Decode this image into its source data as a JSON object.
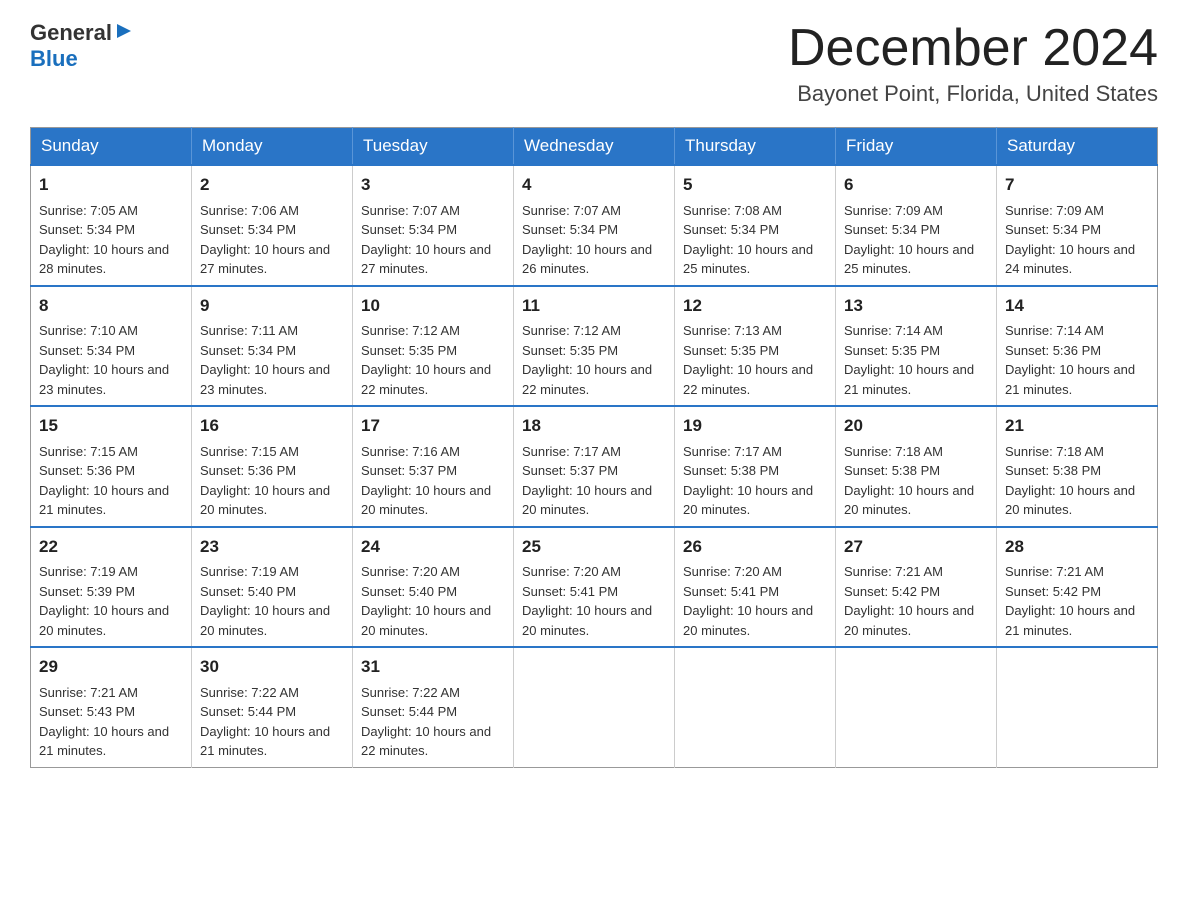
{
  "header": {
    "logo": {
      "general": "General",
      "blue": "Blue"
    },
    "title": "December 2024",
    "subtitle": "Bayonet Point, Florida, United States"
  },
  "calendar": {
    "weekdays": [
      "Sunday",
      "Monday",
      "Tuesday",
      "Wednesday",
      "Thursday",
      "Friday",
      "Saturday"
    ],
    "weeks": [
      [
        {
          "day": "1",
          "sunrise": "7:05 AM",
          "sunset": "5:34 PM",
          "daylight": "10 hours and 28 minutes."
        },
        {
          "day": "2",
          "sunrise": "7:06 AM",
          "sunset": "5:34 PM",
          "daylight": "10 hours and 27 minutes."
        },
        {
          "day": "3",
          "sunrise": "7:07 AM",
          "sunset": "5:34 PM",
          "daylight": "10 hours and 27 minutes."
        },
        {
          "day": "4",
          "sunrise": "7:07 AM",
          "sunset": "5:34 PM",
          "daylight": "10 hours and 26 minutes."
        },
        {
          "day": "5",
          "sunrise": "7:08 AM",
          "sunset": "5:34 PM",
          "daylight": "10 hours and 25 minutes."
        },
        {
          "day": "6",
          "sunrise": "7:09 AM",
          "sunset": "5:34 PM",
          "daylight": "10 hours and 25 minutes."
        },
        {
          "day": "7",
          "sunrise": "7:09 AM",
          "sunset": "5:34 PM",
          "daylight": "10 hours and 24 minutes."
        }
      ],
      [
        {
          "day": "8",
          "sunrise": "7:10 AM",
          "sunset": "5:34 PM",
          "daylight": "10 hours and 23 minutes."
        },
        {
          "day": "9",
          "sunrise": "7:11 AM",
          "sunset": "5:34 PM",
          "daylight": "10 hours and 23 minutes."
        },
        {
          "day": "10",
          "sunrise": "7:12 AM",
          "sunset": "5:35 PM",
          "daylight": "10 hours and 22 minutes."
        },
        {
          "day": "11",
          "sunrise": "7:12 AM",
          "sunset": "5:35 PM",
          "daylight": "10 hours and 22 minutes."
        },
        {
          "day": "12",
          "sunrise": "7:13 AM",
          "sunset": "5:35 PM",
          "daylight": "10 hours and 22 minutes."
        },
        {
          "day": "13",
          "sunrise": "7:14 AM",
          "sunset": "5:35 PM",
          "daylight": "10 hours and 21 minutes."
        },
        {
          "day": "14",
          "sunrise": "7:14 AM",
          "sunset": "5:36 PM",
          "daylight": "10 hours and 21 minutes."
        }
      ],
      [
        {
          "day": "15",
          "sunrise": "7:15 AM",
          "sunset": "5:36 PM",
          "daylight": "10 hours and 21 minutes."
        },
        {
          "day": "16",
          "sunrise": "7:15 AM",
          "sunset": "5:36 PM",
          "daylight": "10 hours and 20 minutes."
        },
        {
          "day": "17",
          "sunrise": "7:16 AM",
          "sunset": "5:37 PM",
          "daylight": "10 hours and 20 minutes."
        },
        {
          "day": "18",
          "sunrise": "7:17 AM",
          "sunset": "5:37 PM",
          "daylight": "10 hours and 20 minutes."
        },
        {
          "day": "19",
          "sunrise": "7:17 AM",
          "sunset": "5:38 PM",
          "daylight": "10 hours and 20 minutes."
        },
        {
          "day": "20",
          "sunrise": "7:18 AM",
          "sunset": "5:38 PM",
          "daylight": "10 hours and 20 minutes."
        },
        {
          "day": "21",
          "sunrise": "7:18 AM",
          "sunset": "5:38 PM",
          "daylight": "10 hours and 20 minutes."
        }
      ],
      [
        {
          "day": "22",
          "sunrise": "7:19 AM",
          "sunset": "5:39 PM",
          "daylight": "10 hours and 20 minutes."
        },
        {
          "day": "23",
          "sunrise": "7:19 AM",
          "sunset": "5:40 PM",
          "daylight": "10 hours and 20 minutes."
        },
        {
          "day": "24",
          "sunrise": "7:20 AM",
          "sunset": "5:40 PM",
          "daylight": "10 hours and 20 minutes."
        },
        {
          "day": "25",
          "sunrise": "7:20 AM",
          "sunset": "5:41 PM",
          "daylight": "10 hours and 20 minutes."
        },
        {
          "day": "26",
          "sunrise": "7:20 AM",
          "sunset": "5:41 PM",
          "daylight": "10 hours and 20 minutes."
        },
        {
          "day": "27",
          "sunrise": "7:21 AM",
          "sunset": "5:42 PM",
          "daylight": "10 hours and 20 minutes."
        },
        {
          "day": "28",
          "sunrise": "7:21 AM",
          "sunset": "5:42 PM",
          "daylight": "10 hours and 21 minutes."
        }
      ],
      [
        {
          "day": "29",
          "sunrise": "7:21 AM",
          "sunset": "5:43 PM",
          "daylight": "10 hours and 21 minutes."
        },
        {
          "day": "30",
          "sunrise": "7:22 AM",
          "sunset": "5:44 PM",
          "daylight": "10 hours and 21 minutes."
        },
        {
          "day": "31",
          "sunrise": "7:22 AM",
          "sunset": "5:44 PM",
          "daylight": "10 hours and 22 minutes."
        },
        null,
        null,
        null,
        null
      ]
    ]
  }
}
